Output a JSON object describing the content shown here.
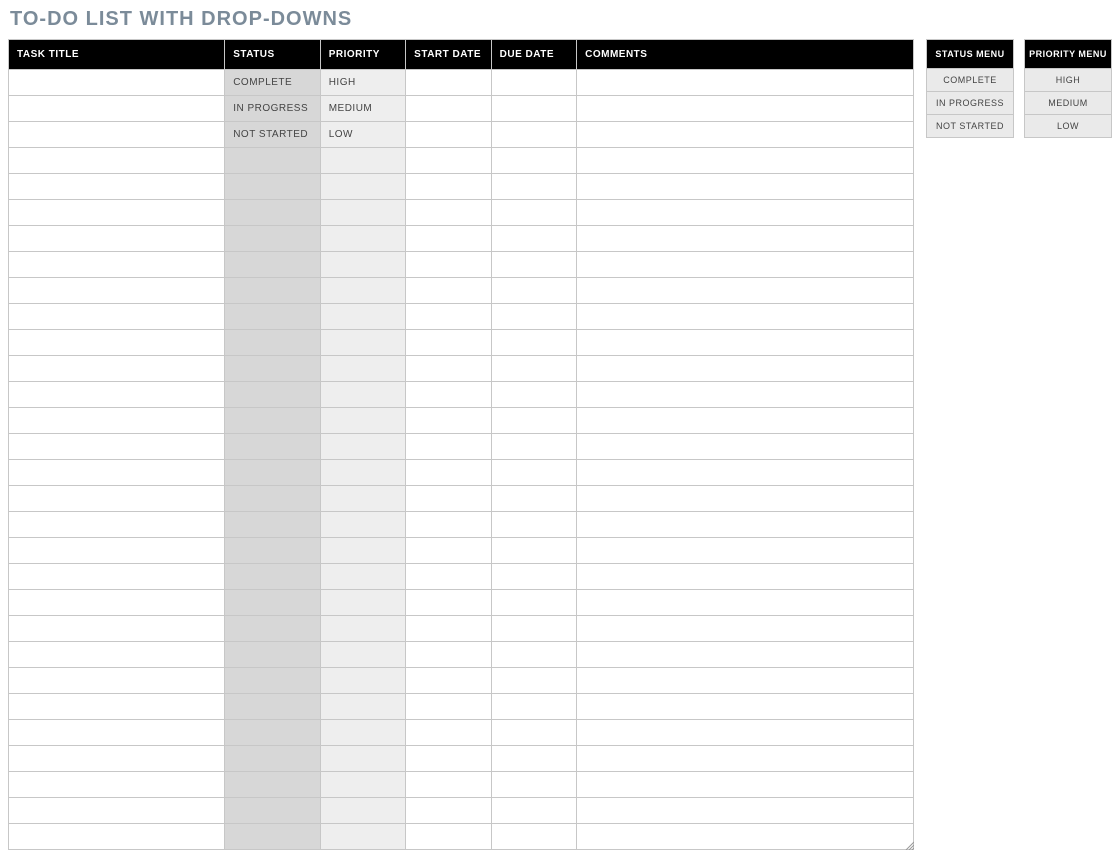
{
  "title": "TO-DO LIST WITH DROP-DOWNS",
  "columns": {
    "task_title": "TASK TITLE",
    "status": "STATUS",
    "priority": "PRIORITY",
    "start_date": "START DATE",
    "due_date": "DUE DATE",
    "comments": "COMMENTS"
  },
  "rows": [
    {
      "task_title": "",
      "status": "COMPLETE",
      "priority": "HIGH",
      "start_date": "",
      "due_date": "",
      "comments": ""
    },
    {
      "task_title": "",
      "status": "IN PROGRESS",
      "priority": "MEDIUM",
      "start_date": "",
      "due_date": "",
      "comments": ""
    },
    {
      "task_title": "",
      "status": "NOT STARTED",
      "priority": "LOW",
      "start_date": "",
      "due_date": "",
      "comments": ""
    },
    {
      "task_title": "",
      "status": "",
      "priority": "",
      "start_date": "",
      "due_date": "",
      "comments": ""
    },
    {
      "task_title": "",
      "status": "",
      "priority": "",
      "start_date": "",
      "due_date": "",
      "comments": ""
    },
    {
      "task_title": "",
      "status": "",
      "priority": "",
      "start_date": "",
      "due_date": "",
      "comments": ""
    },
    {
      "task_title": "",
      "status": "",
      "priority": "",
      "start_date": "",
      "due_date": "",
      "comments": ""
    },
    {
      "task_title": "",
      "status": "",
      "priority": "",
      "start_date": "",
      "due_date": "",
      "comments": ""
    },
    {
      "task_title": "",
      "status": "",
      "priority": "",
      "start_date": "",
      "due_date": "",
      "comments": ""
    },
    {
      "task_title": "",
      "status": "",
      "priority": "",
      "start_date": "",
      "due_date": "",
      "comments": ""
    },
    {
      "task_title": "",
      "status": "",
      "priority": "",
      "start_date": "",
      "due_date": "",
      "comments": ""
    },
    {
      "task_title": "",
      "status": "",
      "priority": "",
      "start_date": "",
      "due_date": "",
      "comments": ""
    },
    {
      "task_title": "",
      "status": "",
      "priority": "",
      "start_date": "",
      "due_date": "",
      "comments": ""
    },
    {
      "task_title": "",
      "status": "",
      "priority": "",
      "start_date": "",
      "due_date": "",
      "comments": ""
    },
    {
      "task_title": "",
      "status": "",
      "priority": "",
      "start_date": "",
      "due_date": "",
      "comments": ""
    },
    {
      "task_title": "",
      "status": "",
      "priority": "",
      "start_date": "",
      "due_date": "",
      "comments": ""
    },
    {
      "task_title": "",
      "status": "",
      "priority": "",
      "start_date": "",
      "due_date": "",
      "comments": ""
    },
    {
      "task_title": "",
      "status": "",
      "priority": "",
      "start_date": "",
      "due_date": "",
      "comments": ""
    },
    {
      "task_title": "",
      "status": "",
      "priority": "",
      "start_date": "",
      "due_date": "",
      "comments": ""
    },
    {
      "task_title": "",
      "status": "",
      "priority": "",
      "start_date": "",
      "due_date": "",
      "comments": ""
    },
    {
      "task_title": "",
      "status": "",
      "priority": "",
      "start_date": "",
      "due_date": "",
      "comments": ""
    },
    {
      "task_title": "",
      "status": "",
      "priority": "",
      "start_date": "",
      "due_date": "",
      "comments": ""
    },
    {
      "task_title": "",
      "status": "",
      "priority": "",
      "start_date": "",
      "due_date": "",
      "comments": ""
    },
    {
      "task_title": "",
      "status": "",
      "priority": "",
      "start_date": "",
      "due_date": "",
      "comments": ""
    },
    {
      "task_title": "",
      "status": "",
      "priority": "",
      "start_date": "",
      "due_date": "",
      "comments": ""
    },
    {
      "task_title": "",
      "status": "",
      "priority": "",
      "start_date": "",
      "due_date": "",
      "comments": ""
    },
    {
      "task_title": "",
      "status": "",
      "priority": "",
      "start_date": "",
      "due_date": "",
      "comments": ""
    },
    {
      "task_title": "",
      "status": "",
      "priority": "",
      "start_date": "",
      "due_date": "",
      "comments": ""
    },
    {
      "task_title": "",
      "status": "",
      "priority": "",
      "start_date": "",
      "due_date": "",
      "comments": ""
    },
    {
      "task_title": "",
      "status": "",
      "priority": "",
      "start_date": "",
      "due_date": "",
      "comments": ""
    }
  ],
  "status_menu": {
    "header": "STATUS MENU",
    "items": [
      "COMPLETE",
      "IN PROGRESS",
      "NOT STARTED"
    ]
  },
  "priority_menu": {
    "header": "PRIORITY MENU",
    "items": [
      "HIGH",
      "MEDIUM",
      "LOW"
    ]
  }
}
